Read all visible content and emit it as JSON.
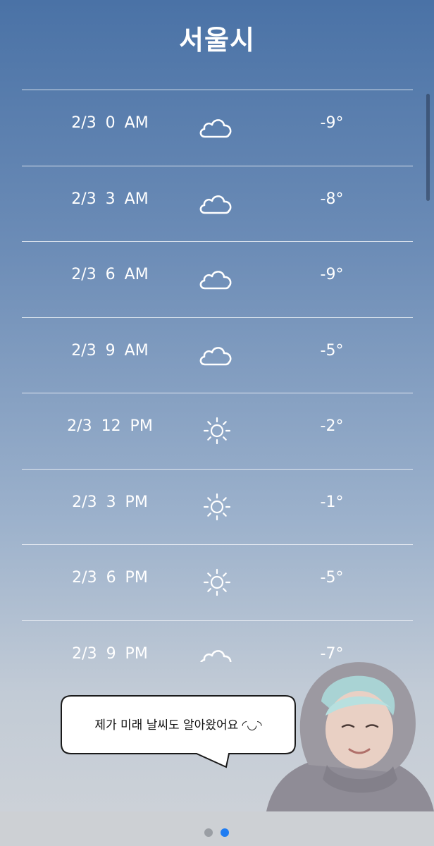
{
  "header": {
    "city": "서울시"
  },
  "forecast": [
    {
      "time": "2/3 0 AM",
      "icon": "cloud-icon",
      "temp": "-9°"
    },
    {
      "time": "2/3 3 AM",
      "icon": "cloud-icon",
      "temp": "-8°"
    },
    {
      "time": "2/3 6 AM",
      "icon": "cloud-icon",
      "temp": "-9°"
    },
    {
      "time": "2/3 9 AM",
      "icon": "cloud-icon",
      "temp": "-5°"
    },
    {
      "time": "2/3 12 PM",
      "icon": "sun-icon",
      "temp": "-2°"
    },
    {
      "time": "2/3 3 PM",
      "icon": "sun-icon",
      "temp": "-1°"
    },
    {
      "time": "2/3 6 PM",
      "icon": "sun-icon",
      "temp": "-5°"
    },
    {
      "time": "2/3 9 PM",
      "icon": "cloud-icon",
      "temp": "-7°"
    }
  ],
  "overlay": {
    "speech": "제가 미래 날씨도 알아왔어요 ◜◡◝"
  },
  "pager": {
    "pages": 2,
    "active": 2
  },
  "colors": {
    "active_dot": "#1f7cf2",
    "inactive_dot": "#9a9ea4"
  }
}
